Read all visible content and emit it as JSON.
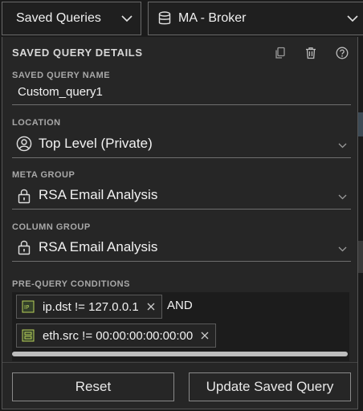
{
  "top_bar": {
    "saved_queries_label": "Saved Queries",
    "source_label": "MA - Broker"
  },
  "panel": {
    "title": "SAVED QUERY DETAILS",
    "tools": [
      "copy-icon",
      "trash-icon",
      "help-icon"
    ],
    "name": {
      "label": "SAVED QUERY NAME",
      "value": "Custom_query1"
    },
    "location": {
      "label": "LOCATION",
      "value": "Top Level (Private)"
    },
    "meta_group": {
      "label": "META GROUP",
      "value": "RSA Email Analysis"
    },
    "column_group": {
      "label": "COLUMN GROUP",
      "value": "RSA Email Analysis"
    },
    "conditions": {
      "label": "PRE-QUERY CONDITIONS",
      "items": [
        {
          "text": "ip.dst != 127.0.0.1",
          "icon": "ip-icon"
        },
        {
          "text": "eth.src != 00:00:00:00:00:00",
          "icon": "eth-icon"
        }
      ],
      "operator": "AND"
    },
    "buttons": {
      "reset": "Reset",
      "update": "Update Saved Query"
    }
  }
}
